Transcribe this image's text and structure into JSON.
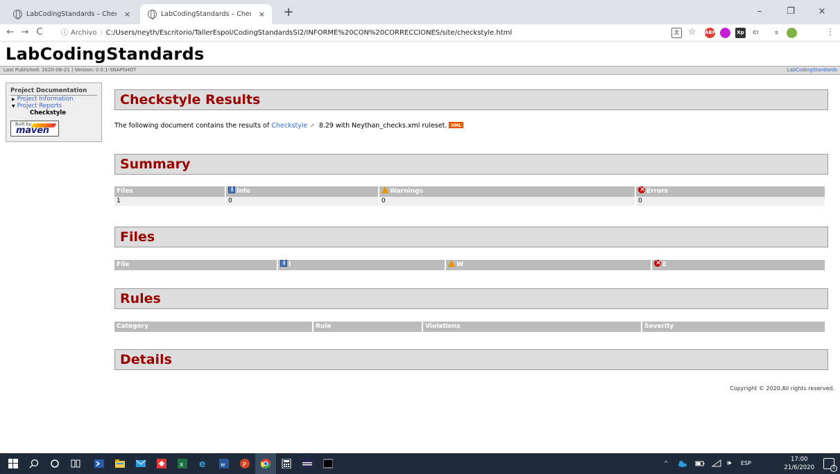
{
  "browser": {
    "tabs": [
      {
        "title": "LabCodingStandards – Checkstyle",
        "close": "×"
      },
      {
        "title": "LabCodingStandards – Checkstyle",
        "close": "×"
      }
    ],
    "new_tab": "+",
    "window_controls": {
      "minimize": "–",
      "restore": "❐",
      "close": "×"
    },
    "nav": {
      "back": "←",
      "forward": "→",
      "reload": "C",
      "info": "ⓘ"
    },
    "address": {
      "scheme_label": "Archivo",
      "separator": "|",
      "url": "C:/Users/neyth/Escritorio/TallerEspol/CodingStandardsSI2/INFORME%20CON%20CORRECCIONES/site/checkstyle.html"
    },
    "toolbar_icons": [
      "translate-icon",
      "star-icon",
      "adblock-icon",
      "extension-icon",
      "xp-extension-icon",
      "code-extension-icon",
      "reading-list-icon",
      "profile-icon",
      "menu-icon"
    ],
    "bookmark_star": "☆",
    "menu": "⋮"
  },
  "page": {
    "banner": "LabCodingStandards",
    "breadcrumbs": {
      "left": "Last Published: 2020-06-21  | Version: 0.0.1-SNAPSHOT",
      "right": "LabCodingStandards"
    },
    "sidebar": {
      "heading": "Project Documentation",
      "items": [
        {
          "label": "Project Information"
        },
        {
          "label": "Project Reports"
        }
      ],
      "current": "Checkstyle",
      "badge": {
        "built_by": "Built by:",
        "brand": "maven"
      }
    },
    "sections": {
      "results": "Checkstyle Results",
      "summary": "Summary",
      "files": "Files",
      "rules": "Rules",
      "details": "Details"
    },
    "intro": {
      "prefix": "The following document contains the results of ",
      "link": "Checkstyle",
      "ext_icon": "⇗",
      "suffix": " 8.29 with Neythan_checks.xml ruleset. ",
      "xml_badge": "XML"
    },
    "summary_table": {
      "headers": [
        "Files",
        "Info",
        "Warnings",
        "Errors"
      ],
      "row": [
        "1",
        "0",
        "0",
        "0"
      ]
    },
    "files_table": {
      "headers": [
        "File",
        "I",
        "W",
        "E"
      ]
    },
    "rules_table": {
      "headers": [
        "Category",
        "Rule",
        "Violations",
        "Severity"
      ]
    },
    "footer": "Copyright © 2020.All rights reserved."
  },
  "taskbar": {
    "tray": {
      "chevron": "^",
      "language": "ESP",
      "speaker": "🕪"
    },
    "clock": {
      "time": "17:00",
      "date": "21/6/2020"
    },
    "notifications": "5"
  },
  "colors": {
    "section_title": "#990000",
    "table_header": "#bbbbbb",
    "link": "#3366cc",
    "taskbar": "#1f2a3a"
  }
}
